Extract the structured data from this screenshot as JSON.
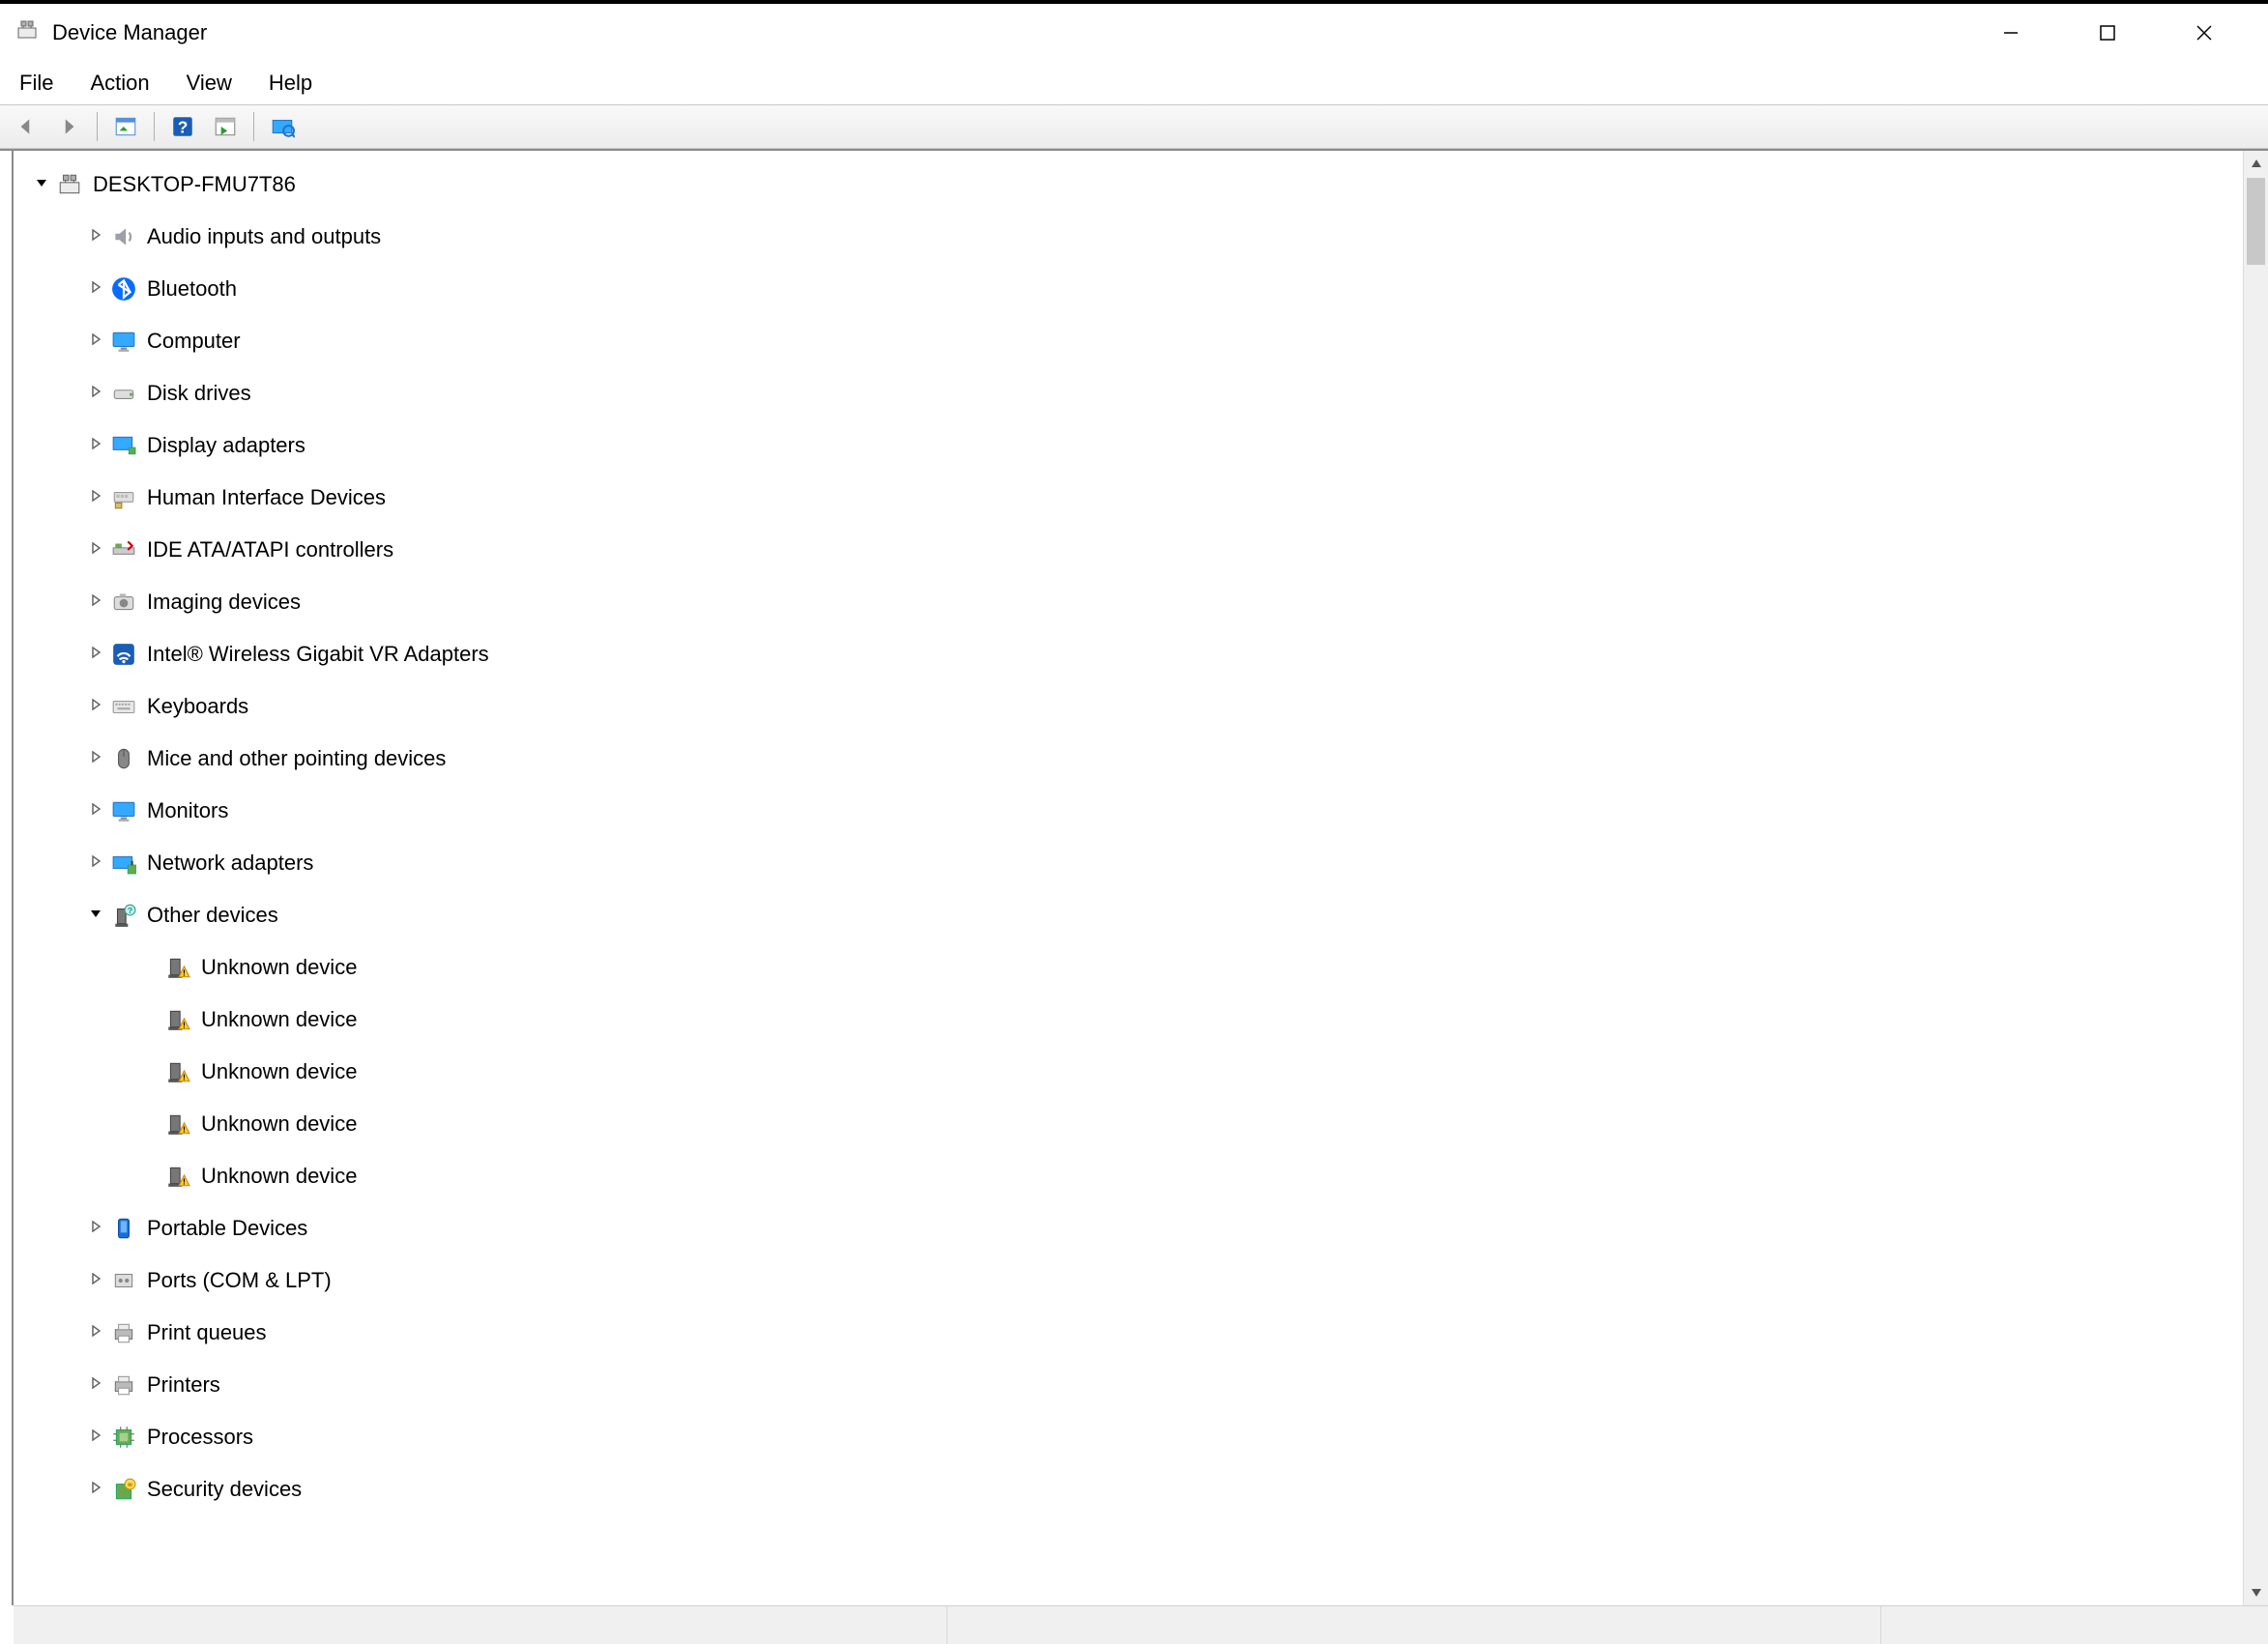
{
  "app": {
    "title": "Device Manager"
  },
  "menubar": {
    "items": [
      "File",
      "Action",
      "View",
      "Help"
    ]
  },
  "tree": {
    "root": {
      "label": "DESKTOP-FMU7T86",
      "expanded": true,
      "icon": "computer-icon"
    },
    "items": [
      {
        "label": "Audio inputs and outputs",
        "icon": "audio-icon",
        "expanded": false
      },
      {
        "label": "Bluetooth",
        "icon": "bluetooth-icon",
        "expanded": false
      },
      {
        "label": "Computer",
        "icon": "monitor-icon",
        "expanded": false
      },
      {
        "label": "Disk drives",
        "icon": "disk-icon",
        "expanded": false
      },
      {
        "label": "Display adapters",
        "icon": "display-adapter-icon",
        "expanded": false
      },
      {
        "label": "Human Interface Devices",
        "icon": "hid-icon",
        "expanded": false
      },
      {
        "label": "IDE ATA/ATAPI controllers",
        "icon": "ide-icon",
        "expanded": false
      },
      {
        "label": "Imaging devices",
        "icon": "camera-icon",
        "expanded": false
      },
      {
        "label": "Intel® Wireless Gigabit VR Adapters",
        "icon": "wireless-icon",
        "expanded": false
      },
      {
        "label": "Keyboards",
        "icon": "keyboard-icon",
        "expanded": false
      },
      {
        "label": "Mice and other pointing devices",
        "icon": "mouse-icon",
        "expanded": false
      },
      {
        "label": "Monitors",
        "icon": "monitor-icon",
        "expanded": false
      },
      {
        "label": "Network adapters",
        "icon": "network-icon",
        "expanded": false
      },
      {
        "label": "Other devices",
        "icon": "other-devices-icon",
        "expanded": true,
        "children": [
          {
            "label": "Unknown device",
            "icon": "unknown-device-icon"
          },
          {
            "label": "Unknown device",
            "icon": "unknown-device-icon"
          },
          {
            "label": "Unknown device",
            "icon": "unknown-device-icon"
          },
          {
            "label": "Unknown device",
            "icon": "unknown-device-icon"
          },
          {
            "label": "Unknown device",
            "icon": "unknown-device-icon"
          }
        ]
      },
      {
        "label": "Portable Devices",
        "icon": "portable-icon",
        "expanded": false
      },
      {
        "label": "Ports (COM & LPT)",
        "icon": "port-icon",
        "expanded": false
      },
      {
        "label": "Print queues",
        "icon": "printer-icon",
        "expanded": false
      },
      {
        "label": "Printers",
        "icon": "printer-icon",
        "expanded": false
      },
      {
        "label": "Processors",
        "icon": "processor-icon",
        "expanded": false
      },
      {
        "label": "Security devices",
        "icon": "security-icon",
        "expanded": false
      }
    ]
  }
}
